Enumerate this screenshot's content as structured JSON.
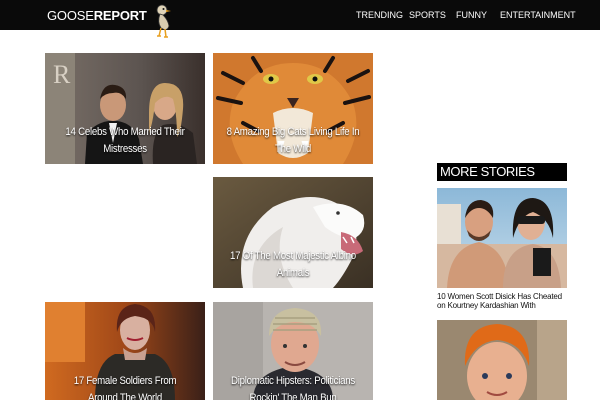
{
  "header": {
    "logo_light": "GOOSE",
    "logo_bold": "REPORT",
    "nav": [
      "TRENDING",
      "SPORTS",
      "FUNNY",
      "ENTERTAINMENT"
    ]
  },
  "cards": [
    {
      "title": "14 Celebs Who Married Their Mistresses"
    },
    {
      "title": "8 Amazing Big Cats Living Life In The Wild"
    },
    {
      "title": "17 Of The Most Majestic Albino Animals"
    },
    {
      "title": "17 Female Soldiers From Around The World"
    },
    {
      "title": "Diplomatic Hipsters: Politicians Rockin' The Man Bun"
    }
  ],
  "sidebar": {
    "title": "MORE STORIES",
    "stories": [
      {
        "caption": "10 Women Scott Disick Has Cheated on Kourtney Kardashian With"
      }
    ]
  },
  "colors": {
    "header_bg": "#0a0a0a",
    "text_light": "#ffffff",
    "sidebar_title_bg": "#000000"
  }
}
